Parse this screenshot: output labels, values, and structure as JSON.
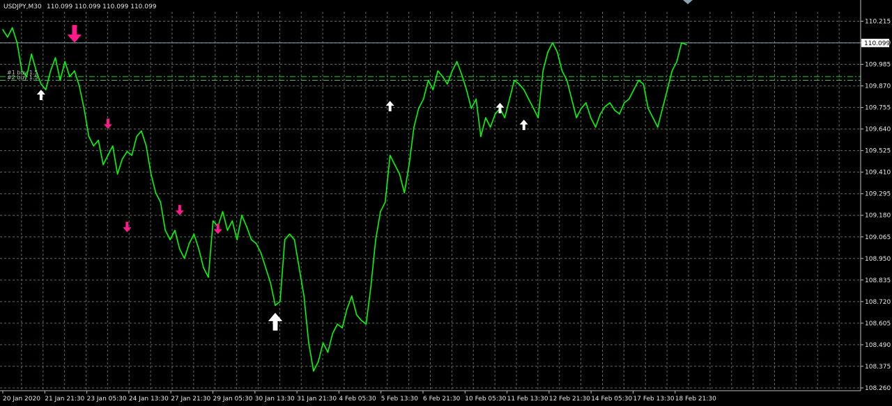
{
  "header": {
    "symbol_label": "USDJPY,M30",
    "ohlc_label": "110.099 110.099 110.099 110.099"
  },
  "colors": {
    "background": "#000000",
    "grid": "#5a6e5a",
    "price_line": "#00ff00",
    "axis": "#c0c0c0",
    "text": "#e8e8e8",
    "sell_arrow": "#ff1a8c",
    "buy_arrow": "#ffffff",
    "level_line": "#33cc33",
    "bid_line": "#8aa3b3"
  },
  "level_labels": [
    "#1 buy 1.5",
    "#2 buy 1.5"
  ],
  "chart_data": {
    "type": "line",
    "title": "USDJPY,M30",
    "xlabel": "",
    "ylabel": "",
    "ylim": [
      108.245,
      110.265
    ],
    "grid": true,
    "y_ticks": [
      "110.215",
      "110.100",
      "109.985",
      "109.870",
      "109.755",
      "109.640",
      "109.525",
      "109.410",
      "109.295",
      "109.180",
      "109.065",
      "108.950",
      "108.835",
      "108.720",
      "108.605",
      "108.490",
      "108.375",
      "108.260"
    ],
    "x_ticks": [
      "20 Jan 2020",
      "21 Jan 21:30",
      "23 Jan 05:30",
      "24 Jan 13:30",
      "27 Jan 21:30",
      "29 Jan 05:30",
      "30 Jan 13:30",
      "31 Jan 21:30",
      "4 Feb 05:30",
      "5 Feb 13:30",
      "6 Feb 21:30",
      "10 Feb 05:30",
      "11 Feb 13:30",
      "12 Feb 21:30",
      "14 Feb 05:30",
      "17 Feb 13:30",
      "18 Feb 21:30"
    ],
    "current_price": "110.099",
    "levels": [
      109.92,
      109.9
    ],
    "series": [
      {
        "values": [
          110.17,
          110.13,
          110.18,
          110.1,
          109.95,
          109.92,
          110.04,
          109.95,
          109.88,
          109.85,
          109.95,
          110.02,
          109.9,
          110.0,
          109.92,
          109.95,
          109.87,
          109.75,
          109.6,
          109.55,
          109.58,
          109.45,
          109.5,
          109.55,
          109.4,
          109.48,
          109.52,
          109.5,
          109.6,
          109.63,
          109.55,
          109.4,
          109.3,
          109.25,
          109.1,
          109.05,
          109.1,
          109.0,
          108.95,
          109.03,
          109.08,
          109.0,
          108.9,
          108.85,
          109.15,
          109.12,
          109.2,
          109.1,
          109.15,
          109.05,
          109.18,
          109.12,
          109.05,
          109.03,
          108.98,
          108.9,
          108.82,
          108.7,
          108.72,
          109.05,
          109.08,
          109.05,
          108.9,
          108.75,
          108.5,
          108.35,
          108.4,
          108.5,
          108.45,
          108.55,
          108.6,
          108.58,
          108.68,
          108.75,
          108.65,
          108.62,
          108.6,
          108.8,
          109.05,
          109.2,
          109.25,
          109.5,
          109.45,
          109.4,
          109.3,
          109.45,
          109.65,
          109.75,
          109.8,
          109.9,
          109.85,
          109.95,
          109.92,
          109.88,
          109.95,
          110.0,
          109.93,
          109.85,
          109.75,
          109.8,
          109.6,
          109.7,
          109.65,
          109.72,
          109.75,
          109.7,
          109.8,
          109.9,
          109.88,
          109.85,
          109.8,
          109.75,
          109.7,
          109.95,
          110.05,
          110.1,
          110.05,
          109.95,
          109.9,
          109.8,
          109.7,
          109.75,
          109.78,
          109.7,
          109.65,
          109.72,
          109.76,
          109.78,
          109.74,
          109.72,
          109.78,
          109.8,
          109.85,
          109.9,
          109.88,
          109.75,
          109.7,
          109.65,
          109.75,
          109.85,
          109.95,
          110.0,
          110.1,
          110.09
        ]
      }
    ],
    "signals": [
      {
        "type": "sell",
        "size": "large",
        "index": 15,
        "value": 110.1
      },
      {
        "type": "buy",
        "size": "small",
        "index": 8,
        "value": 109.85
      },
      {
        "type": "sell",
        "size": "small",
        "index": 22,
        "value": 109.64
      },
      {
        "type": "sell",
        "size": "small",
        "index": 26,
        "value": 109.09
      },
      {
        "type": "sell",
        "size": "small",
        "index": 37,
        "value": 109.18
      },
      {
        "type": "sell",
        "size": "small",
        "index": 45,
        "value": 109.08
      },
      {
        "type": "buy",
        "size": "large",
        "index": 57,
        "value": 108.66
      },
      {
        "type": "buy",
        "size": "small",
        "index": 81,
        "value": 109.79
      },
      {
        "type": "buy",
        "size": "small",
        "index": 104,
        "value": 109.78
      },
      {
        "type": "buy",
        "size": "small",
        "index": 109,
        "value": 109.69
      }
    ]
  }
}
